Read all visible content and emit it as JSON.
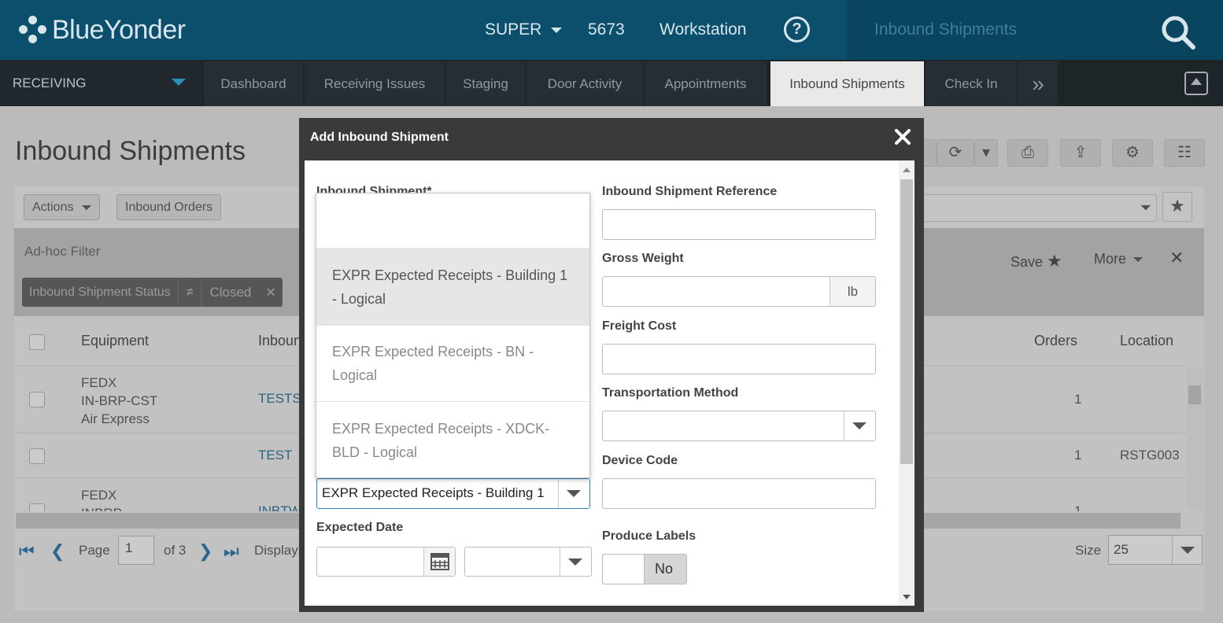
{
  "app": {
    "brand": "BlueYonder",
    "user_menu": "SUPER",
    "warehouse_id": "5673",
    "workstation": "Workstation",
    "help": "?",
    "search_context": "Inbound Shipments"
  },
  "nav": {
    "module": "RECEIVING",
    "tabs": [
      "Dashboard",
      "Receiving Issues",
      "Staging",
      "Door Activity",
      "Appointments",
      "Inbound Shipments",
      "Check In"
    ],
    "more": "»"
  },
  "page": {
    "title": "Inbound Shipments",
    "actions_label": "Actions",
    "inbound_orders_label": "Inbound Orders",
    "filter": {
      "title": "Ad-hoc Filter",
      "save_label": "Save",
      "more_label": "More",
      "chip_field": "Inbound Shipment Status",
      "chip_operator": "≠",
      "chip_value": "Closed"
    },
    "columns": {
      "equipment": "Equipment",
      "inbound": "Inboun",
      "orders": "Orders",
      "location": "Location"
    },
    "rows": [
      {
        "equipment_1": "FEDX",
        "equipment_2": "IN-BRP-CST",
        "equipment_3": "Air Express",
        "inbound": "TESTS",
        "orders": "1",
        "location": ""
      },
      {
        "inbound": "TEST",
        "orders": "1",
        "location": "RSTG003"
      },
      {
        "equipment_1": "FEDX",
        "equipment_2": "INBRP",
        "inbound": "INBTW",
        "orders": "1"
      }
    ],
    "pager": {
      "page_label": "Page",
      "page_value": "1",
      "of_label": "of 3",
      "display_label": "Displayi",
      "size_label": "Size",
      "size_value": "25"
    }
  },
  "modal": {
    "title": "Add Inbound Shipment",
    "fields": {
      "inbound_shipment": "Inbound Shipment*",
      "reference": "Inbound Shipment Reference",
      "gross_weight": "Gross Weight",
      "weight_unit": "lb",
      "freight_cost": "Freight Cost",
      "transport_method": "Transportation Method",
      "device_code": "Device Code",
      "expected_date": "Expected Date",
      "produce_labels": "Produce Labels",
      "produce_labels_value": "No"
    },
    "selected_value": "EXPR Expected Receipts - Building 1",
    "dropdown_options": [
      "EXPR Expected Receipts - Building 1 - Logical",
      "EXPR Expected Receipts - BN - Logical",
      "EXPR Expected Receipts - XDCK-BLD - Logical"
    ]
  }
}
